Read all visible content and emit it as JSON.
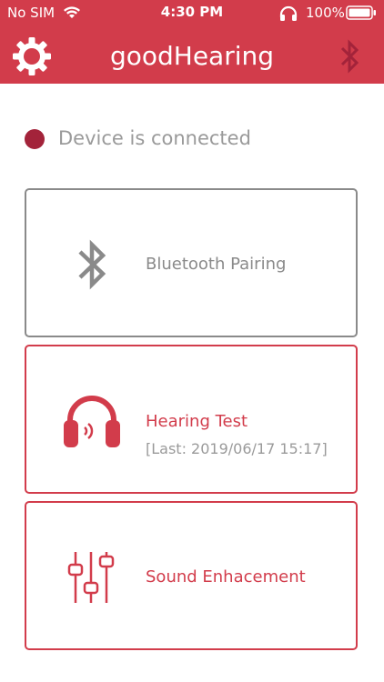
{
  "status_bar": {
    "carrier": "No SIM",
    "time": "4:30 PM",
    "battery": "100%"
  },
  "navbar": {
    "title": "goodHearing"
  },
  "connection": {
    "status_text": "Device is connected",
    "dot_color": "#a3233a"
  },
  "cards": {
    "bluetooth": {
      "label": "Bluetooth Pairing"
    },
    "hearing_test": {
      "label": "Hearing Test",
      "last": "[Last: 2019/06/17 15:17]"
    },
    "sound": {
      "label": "Sound Enhacement"
    }
  },
  "colors": {
    "brand_red": "#d23c4b",
    "dark_red": "#a3233a",
    "gray": "#8a8a8a"
  }
}
